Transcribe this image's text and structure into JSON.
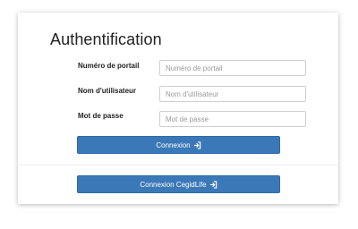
{
  "page": {
    "title": "Authentification"
  },
  "form": {
    "fields": [
      {
        "label": "Numéro de portail",
        "value": "",
        "placeholder": "Numéro de portail"
      },
      {
        "label": "Nom d'utilisateur",
        "value": "",
        "placeholder": "Nom d'utilisateur"
      },
      {
        "label": "Mot de passe",
        "value": "",
        "placeholder": "Mot de passe"
      }
    ],
    "login_button": {
      "label": "Connexion",
      "icon": "sign-in-icon"
    },
    "cegid_button": {
      "label": "Connexion CegidLife",
      "icon": "sign-in-icon"
    }
  },
  "colors": {
    "button_bg": "#3b78b8",
    "button_text": "#ffffff",
    "title_text": "#222222"
  }
}
